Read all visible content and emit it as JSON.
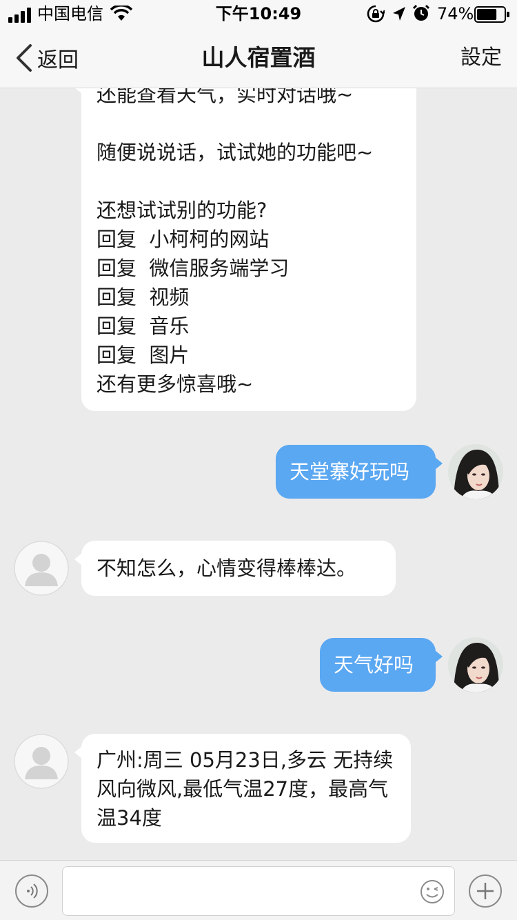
{
  "status_bar": {
    "carrier": "中国电信",
    "time": "下午10:49",
    "battery_percent": "74%",
    "battery_level": 0.74
  },
  "nav": {
    "back_label": "返回",
    "title": "山人宿置酒",
    "settings_label": "設定"
  },
  "messages": [
    {
      "from": "bot",
      "text": "还能查看天气，实时对话哦~\n\n随便说说话，试试她的功能吧~\n\n还想试试别的功能?\n回复  小柯柯的网站\n回复  微信服务端学习\n回复  视频\n回复  音乐\n回复  图片\n还有更多惊喜哦~"
    },
    {
      "from": "user",
      "text": "天堂寨好玩吗"
    },
    {
      "from": "bot",
      "text": "不知怎么，心情变得棒棒达。"
    },
    {
      "from": "user",
      "text": "天气好吗"
    },
    {
      "from": "bot",
      "text": "广州:周三 05月23日,多云 无持续风向微风,最低气温27度，最高气温34度"
    }
  ],
  "input": {
    "value": "",
    "voice_icon": "voice-icon",
    "emoji_icon": "emoji-icon",
    "add_icon": "plus-icon"
  },
  "colors": {
    "user_bubble": "#5aa7f2",
    "bot_bubble": "#ffffff",
    "background": "#ebebeb"
  }
}
